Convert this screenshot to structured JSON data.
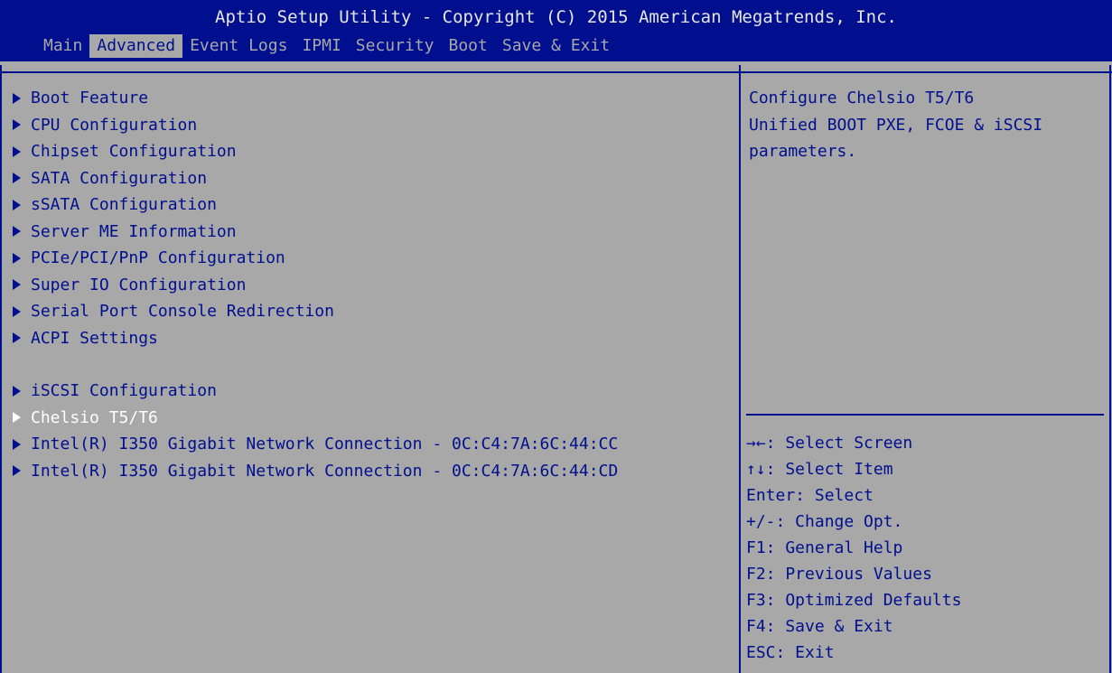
{
  "title": "Aptio Setup Utility - Copyright (C) 2015 American Megatrends, Inc.",
  "menu": [
    {
      "label": "Main",
      "active": false
    },
    {
      "label": "Advanced",
      "active": true
    },
    {
      "label": "Event Logs",
      "active": false
    },
    {
      "label": "IPMI",
      "active": false
    },
    {
      "label": "Security",
      "active": false
    },
    {
      "label": "Boot",
      "active": false
    },
    {
      "label": "Save & Exit",
      "active": false
    }
  ],
  "items": [
    {
      "label": "Boot Feature"
    },
    {
      "label": "CPU Configuration"
    },
    {
      "label": "Chipset Configuration"
    },
    {
      "label": "SATA Configuration"
    },
    {
      "label": "sSATA Configuration"
    },
    {
      "label": "Server ME Information"
    },
    {
      "label": "PCIe/PCI/PnP Configuration"
    },
    {
      "label": "Super IO Configuration"
    },
    {
      "label": "Serial Port Console Redirection"
    },
    {
      "label": "ACPI Settings"
    },
    {
      "label": "iSCSI Configuration"
    },
    {
      "label": "Chelsio T5/T6"
    },
    {
      "label": "Intel(R) I350 Gigabit Network Connection - 0C:C4:7A:6C:44:CC"
    },
    {
      "label": "Intel(R) I350 Gigabit Network Connection - 0C:C4:7A:6C:44:CD"
    }
  ],
  "selected_item": "Chelsio T5/T6",
  "help": [
    "Configure Chelsio T5/T6",
    "Unified BOOT PXE, FCOE & iSCSI",
    "parameters."
  ],
  "keys": [
    "→←: Select Screen",
    "↑↓: Select Item",
    "Enter: Select",
    "+/-: Change Opt.",
    "F1: General Help",
    "F2: Previous Values",
    "F3: Optimized Defaults",
    "F4: Save & Exit",
    "ESC: Exit"
  ],
  "colors": {
    "header_bg": "#000f8e",
    "body_bg": "#a8a8a8",
    "text": "#000f8e",
    "selected_text": "#ffffff"
  }
}
